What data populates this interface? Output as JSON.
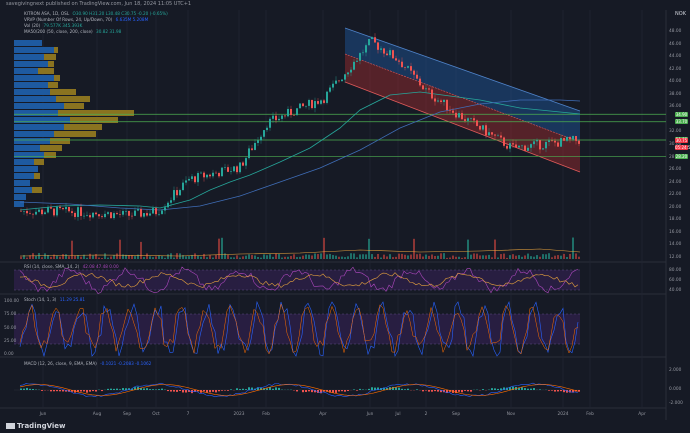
{
  "header": {
    "published": "savegivingnext published on TradingView.com, Jun 18, 2024 11:05 UTC+1",
    "currency": "NOK"
  },
  "legend": {
    "main": {
      "label": "KITRON ASA, 1D, OSL",
      "values": "O30.90 H31.20 L30.48 C30.75 -0.20 (-0.65%)",
      "color": "#26a69a"
    },
    "vrvp": {
      "label": "VRVP (Number Of Rows, 24, Up/Down, 70)",
      "values": "6.635M 5.208M",
      "color": "#2962ff"
    },
    "vol": {
      "label": "Vol (20)",
      "values": "79.577K 345.393K",
      "color": "#26a69a"
    },
    "ma": {
      "label": "MA50/200 (50, close, 200, close)",
      "values": "30.82 31.98",
      "color": "#26a69a"
    },
    "rsi": {
      "label": "RSI (14, close, SMA, 14, 2)",
      "values": "42.08 47.48 0.00",
      "color": "#ab47bc"
    },
    "stoch": {
      "label": "Stoch (14, 1, 3)",
      "values": "11.29 25.81",
      "color": "#2962ff"
    },
    "macd": {
      "label": "MACD (12, 26, close, 9, EMA, EMA)",
      "values": "-0.1021 -0.2083 -0.1062",
      "color": "#2962ff"
    }
  },
  "price_axis": {
    "ticks": [
      "48.00",
      "46.00",
      "44.00",
      "42.00",
      "40.00",
      "38.00",
      "36.00",
      "32.00",
      "30.00",
      "28.00",
      "26.00",
      "24.00",
      "22.00",
      "20.00",
      "18.00",
      "16.00",
      "14.00",
      "12.00"
    ],
    "tags": [
      {
        "text": "34.90",
        "color": "#4caf50",
        "price": 34.9
      },
      {
        "text": "33.70",
        "color": "#4caf50",
        "price": 33.7
      },
      {
        "text": "30.80",
        "color": "#4caf50",
        "price": 30.8
      },
      {
        "text": "30.75",
        "color": "#f23645",
        "price": 30.75
      },
      {
        "text": "05:24:54",
        "color": "#f23645",
        "price": 29.6
      },
      {
        "text": "28.20",
        "color": "#4caf50",
        "price": 28.2
      }
    ],
    "levels": [
      34.9,
      33.7,
      30.8,
      28.2
    ]
  },
  "rsi_axis": [
    "80.00",
    "60.00",
    "40.00"
  ],
  "stoch_axis": [
    "100.00",
    "75.00",
    "50.00",
    "25.00",
    "0.00"
  ],
  "macd_axis": [
    "2.000",
    "0.000",
    "-2.000"
  ],
  "time_axis": [
    "Jun",
    "Aug",
    "Sep",
    "Oct",
    "7",
    "2023",
    "Feb",
    "Apr",
    "Jun",
    "Jul",
    "2",
    "Sep",
    "Nov",
    "2024",
    "Feb",
    "Apr"
  ],
  "chart_data": {
    "type": "line",
    "title": "KITRON ASA, 1D, OSL",
    "x": [
      "Jun",
      "Aug",
      "Sep",
      "Oct",
      "7",
      "2023",
      "Feb",
      "Apr",
      "Jun",
      "Jul",
      "2",
      "Sep",
      "Nov",
      "2024"
    ],
    "series": [
      {
        "name": "KITRON ASA",
        "values": [
          19.5,
          19.2,
          18.8,
          19.4,
          24.5,
          26.5,
          33.5,
          37.5,
          46.5,
          43.5,
          38.5,
          35.0,
          29.5,
          30.75
        ]
      }
    ],
    "ylim": [
      12,
      48
    ],
    "grid": true,
    "legend": "top-left"
  }
}
